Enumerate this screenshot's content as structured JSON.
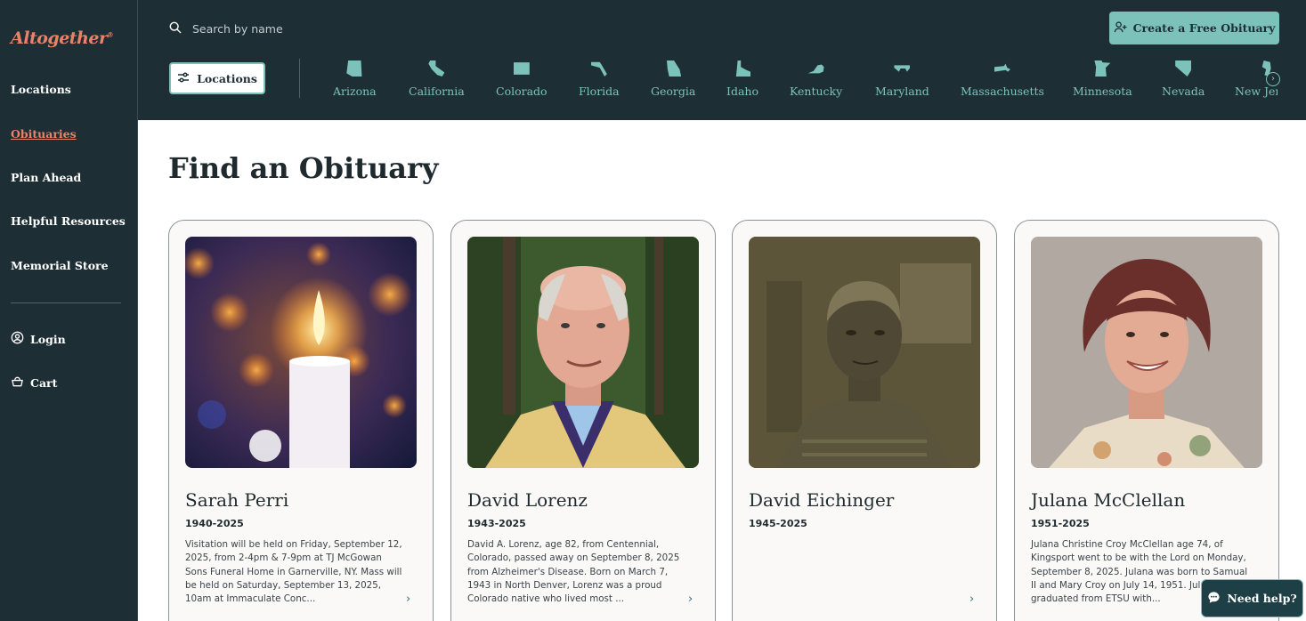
{
  "brand": {
    "logo": "Altogether",
    "trademark": "®"
  },
  "sidebar": {
    "items": [
      {
        "label": "Locations"
      },
      {
        "label": "Obituaries"
      },
      {
        "label": "Plan Ahead"
      },
      {
        "label": "Helpful Resources"
      },
      {
        "label": "Memorial Store"
      }
    ],
    "login_label": "Login",
    "cart_label": "Cart"
  },
  "header": {
    "search_placeholder": "Search by name",
    "create_label": "Create a Free Obituary",
    "locations_label": "Locations",
    "states": [
      "Arizona",
      "California",
      "Colorado",
      "Florida",
      "Georgia",
      "Idaho",
      "Kentucky",
      "Maryland",
      "Massachusetts",
      "Minnesota",
      "Nevada",
      "New Jersey"
    ]
  },
  "main": {
    "title": "Find an Obituary",
    "cards": [
      {
        "name": "Sarah Perri",
        "years": "1940-2025",
        "desc": "Visitation will be held on Friday, September 12, 2025, from 2-4pm & 7-9pm at TJ McGowan Sons Funeral Home in Garnerville, NY. Mass will be held on Saturday, September 13, 2025, 10am at Immaculate Conc..."
      },
      {
        "name": "David Lorenz",
        "years": "1943-2025",
        "desc": "David A. Lorenz, age 82, from Centennial, Colorado, passed away on September 8, 2025 from Alzheimer's Disease. Born on March 7, 1943 in North Denver, Lorenz was a proud Colorado native who lived most ..."
      },
      {
        "name": "David Eichinger",
        "years": "1945-2025",
        "desc": ""
      },
      {
        "name": "Julana McClellan",
        "years": "1951-2025",
        "desc": "Julana Christine Croy McClellan age 74, of Kingsport went to be with the Lord on Monday, September 8, 2025. Julana was born to Samual II and Mary Croy on July 14, 1951. Julana graduated from ETSU with..."
      }
    ]
  },
  "help": {
    "label": "Need help?"
  },
  "colors": {
    "dark": "#1e2e35",
    "teal": "#7cc2bb",
    "coral": "#e8836a"
  }
}
